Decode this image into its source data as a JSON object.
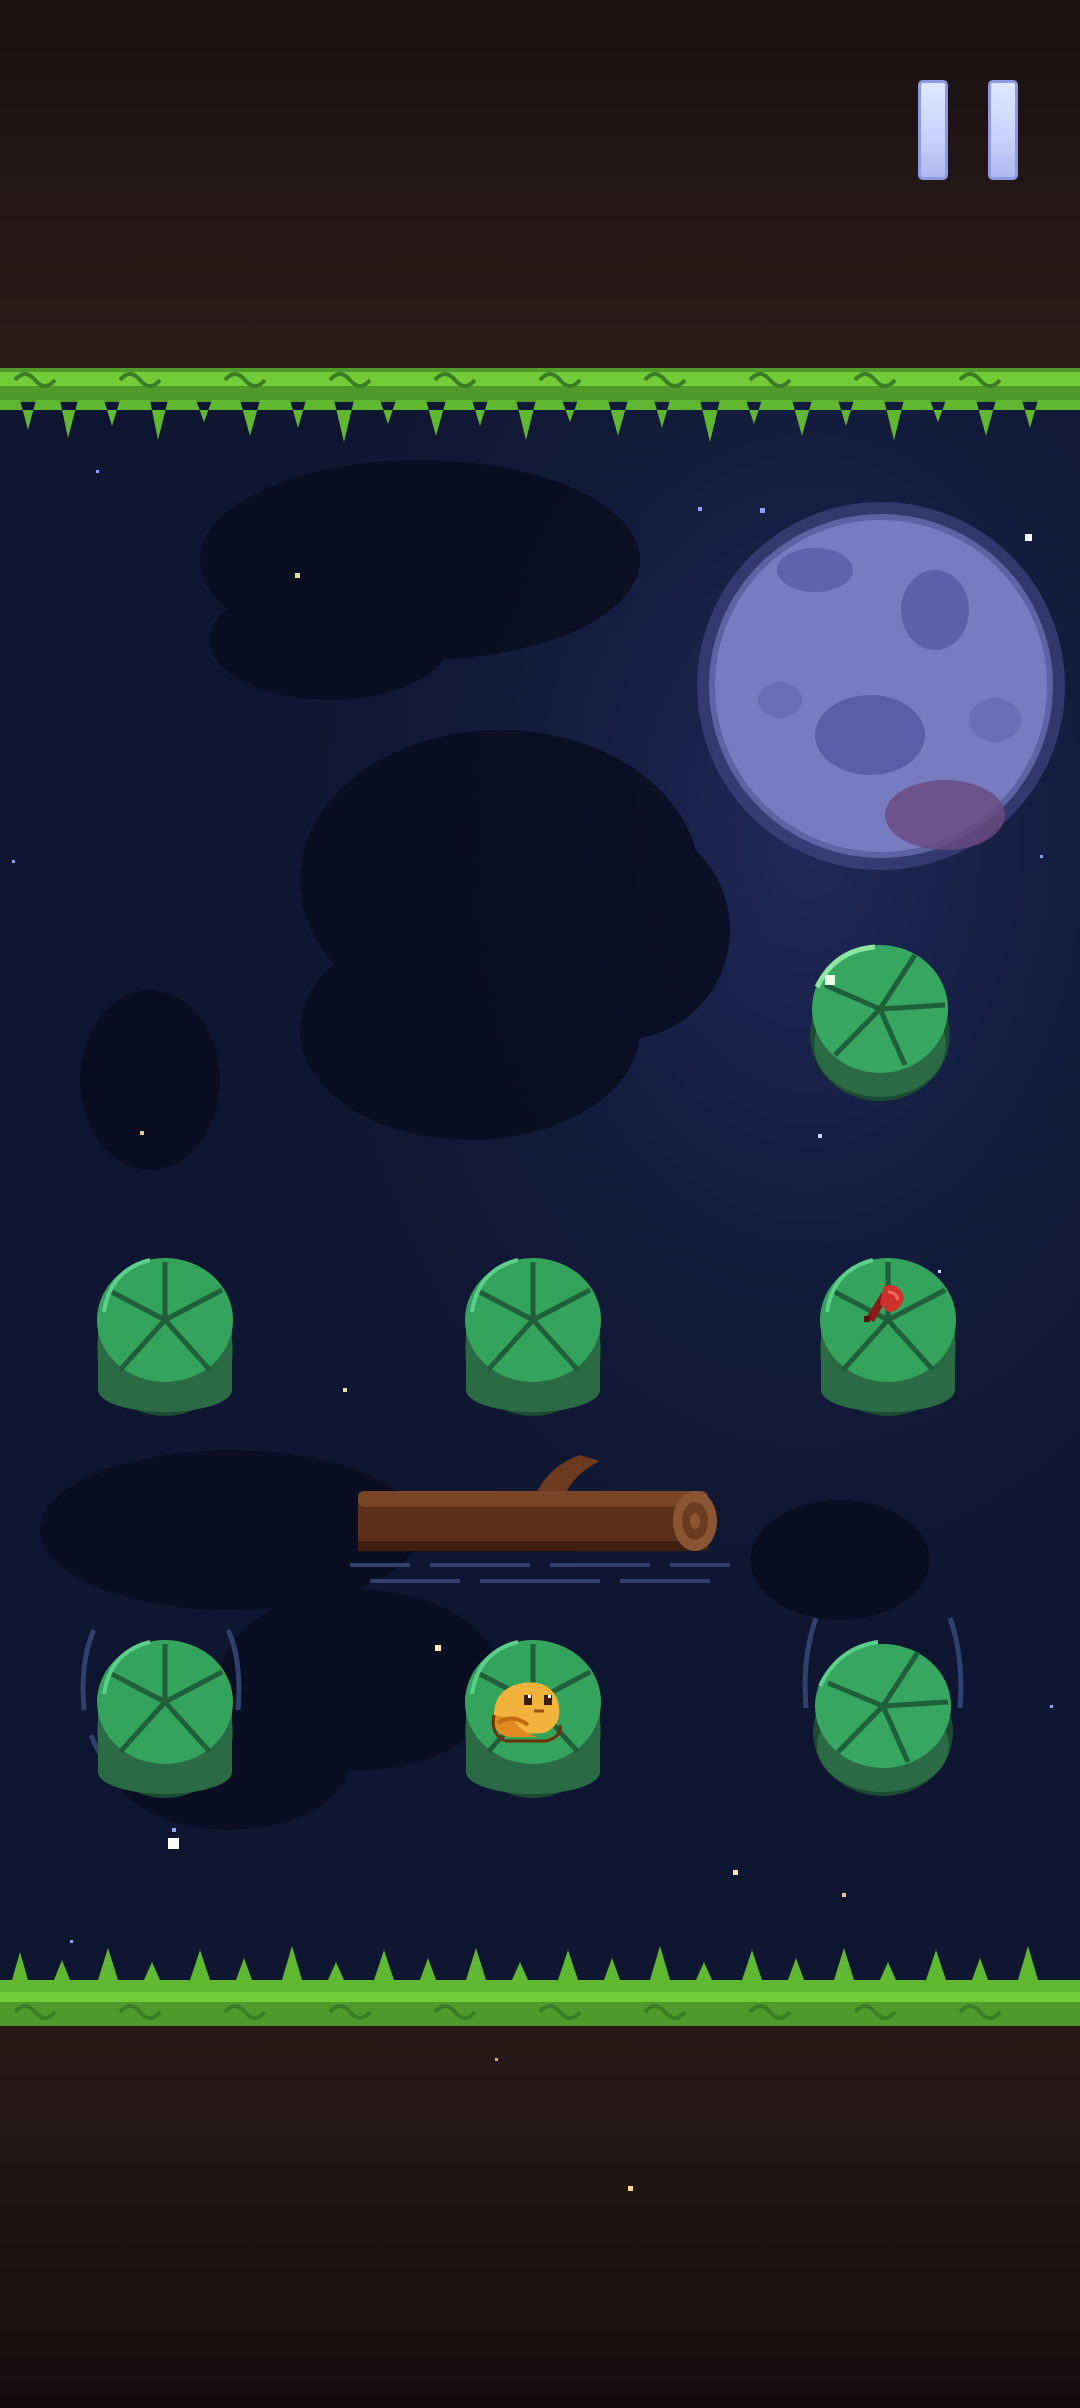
{
  "screen": "pond-level",
  "hud": {
    "pause_button": {
      "icon": "pause-icon"
    }
  },
  "scene": {
    "sky": "night-sky-with-stars",
    "moon": {
      "icon": "moon",
      "phase": "full"
    },
    "banks": [
      "grass-top",
      "grass-bottom"
    ]
  },
  "board": {
    "lily_pads": [
      {
        "id": "pad-upper-right",
        "state": "tilted"
      },
      {
        "id": "pad-row1-left",
        "state": "still"
      },
      {
        "id": "pad-row1-center",
        "state": "still"
      },
      {
        "id": "pad-row1-right",
        "state": "still",
        "item": "bug"
      },
      {
        "id": "pad-row2-left",
        "state": "wobbling"
      },
      {
        "id": "pad-row2-center",
        "state": "still",
        "item": "frog"
      },
      {
        "id": "pad-row2-right",
        "state": "wobbling-tilted"
      }
    ],
    "log": {
      "icon": "log",
      "state": "floating"
    },
    "player": {
      "icon": "frog",
      "color": "#f2b33d"
    },
    "collectible": {
      "icon": "bug",
      "color": "#d0312d"
    }
  },
  "palette": {
    "pad_green": "#3fbf6a",
    "pad_dark": "#1f5f3a",
    "grass_light": "#7ddc3a",
    "grass_dark": "#3d8a2a",
    "water": "#10173a",
    "soil": "#2a1a1b",
    "log_brown": "#6b3a1f"
  }
}
